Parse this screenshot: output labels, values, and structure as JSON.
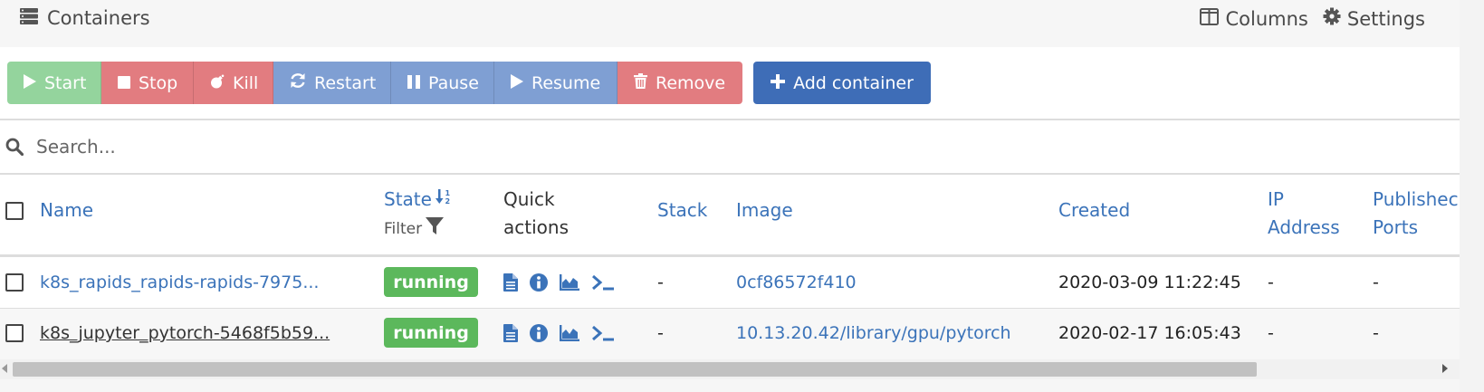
{
  "header": {
    "title": "Containers",
    "columns_label": "Columns",
    "settings_label": "Settings"
  },
  "toolbar": {
    "start": "Start",
    "stop": "Stop",
    "kill": "Kill",
    "restart": "Restart",
    "pause": "Pause",
    "resume": "Resume",
    "remove": "Remove",
    "add_container": "Add container"
  },
  "search": {
    "placeholder": "Search..."
  },
  "table": {
    "headers": {
      "name": "Name",
      "state": "State",
      "state_filter": "Filter",
      "quick_actions_1": "Quick",
      "quick_actions_2": "actions",
      "stack": "Stack",
      "image": "Image",
      "created": "Created",
      "ip_1": "IP",
      "ip_2": "Address",
      "published_1": "Publishec",
      "published_2": "Ports"
    },
    "rows": [
      {
        "name": "k8s_rapids_rapids-rapids-7975...",
        "state": "running",
        "stack": "-",
        "image": "0cf86572f410",
        "created": "2020-03-09 11:22:45",
        "ip": "-",
        "ports": "-"
      },
      {
        "name": "k8s_jupyter_pytorch-5468f5b59...",
        "state": "running",
        "stack": "-",
        "image": "10.13.20.42/library/gpu/pytorch",
        "created": "2020-02-17 16:05:43",
        "ip": "-",
        "ports": "-"
      }
    ]
  },
  "icons": [
    "list-icon",
    "columns-icon",
    "gear-icon",
    "play-icon",
    "stop-icon",
    "bomb-icon",
    "refresh-icon",
    "pause-icon",
    "trash-icon",
    "plus-icon",
    "search-icon",
    "sort-icon",
    "filter-icon",
    "file-icon",
    "info-icon",
    "chart-icon",
    "terminal-icon"
  ],
  "colors": {
    "start": "#94d49d",
    "danger": "#e27c80",
    "primary_light": "#7f9fd3",
    "primary": "#3e6db7",
    "link": "#3b73b9",
    "running": "#5cb85c"
  }
}
